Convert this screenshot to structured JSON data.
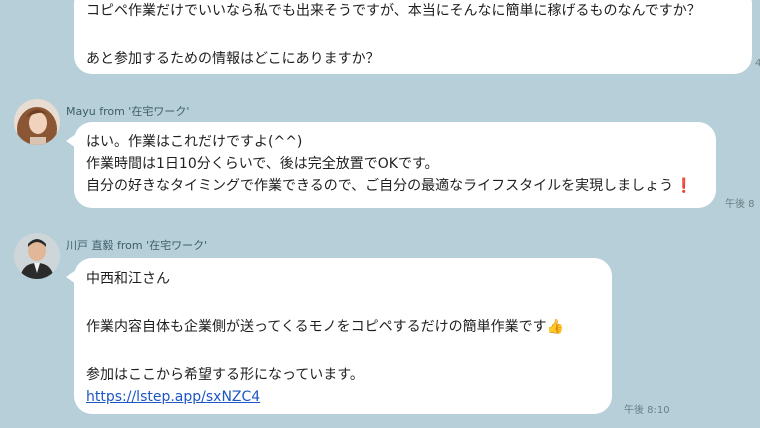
{
  "messages": [
    {
      "lines": [
        "コピペ作業だけでいいなら私でも出来そうですが、本当にそんなに簡単に稼げるものなんですか？",
        "あと参加するための情報はどこにありますか？"
      ],
      "time": "4"
    },
    {
      "sender": "Mayu from '在宅ワーク'",
      "lines": [
        "はい。作業はこれだけですよ(^^)",
        "作業時間は1日10分くらいで、後は完全放置でOKです。",
        "自分の好きなタイミングで作業できるので、ご自分の最適なライフスタイルを実現しましょう"
      ],
      "time": "午後 8"
    },
    {
      "sender": "川戸 直毅 from '在宅ワーク'",
      "lines": [
        "中西和江さん",
        "作業内容自体も企業側が送ってくるモノをコピペするだけの簡単作業です",
        "参加はここから希望する形になっています。"
      ],
      "link": "https://lstep.app/sxNZC4",
      "time": "午後 8:10"
    }
  ],
  "icons": {
    "exclamation": "❗",
    "thumbs_up": "👍"
  }
}
